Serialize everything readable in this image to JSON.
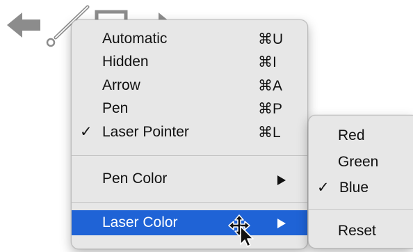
{
  "toolbar": {
    "icons": [
      "back-arrow-icon",
      "pen-icon",
      "rectangle-icon",
      "forward-arrow-icon"
    ]
  },
  "main_menu": {
    "items": [
      {
        "label": "Automatic",
        "shortcut": "⌘U",
        "checked": false
      },
      {
        "label": "Hidden",
        "shortcut": "⌘I",
        "checked": false
      },
      {
        "label": "Arrow",
        "shortcut": "⌘A",
        "checked": false
      },
      {
        "label": "Pen",
        "shortcut": "⌘P",
        "checked": false
      },
      {
        "label": "Laser Pointer",
        "shortcut": "⌘L",
        "checked": true,
        "check_mark": "✓"
      }
    ],
    "pen_color": {
      "label": "Pen Color",
      "has_submenu": true
    },
    "laser_color": {
      "label": "Laser Color",
      "has_submenu": true,
      "highlighted": true
    }
  },
  "submenu": {
    "items": [
      {
        "label": "Red",
        "checked": false
      },
      {
        "label": "Green",
        "checked": false
      },
      {
        "label": "Blue",
        "checked": true,
        "check_mark": "✓"
      }
    ],
    "reset": {
      "label": "Reset"
    }
  },
  "colors": {
    "menu_background": "#e7e7e7",
    "highlight": "#1f63d6",
    "toolbar_icon": "#8c8c8c"
  },
  "cursor": "move-cursor-icon"
}
